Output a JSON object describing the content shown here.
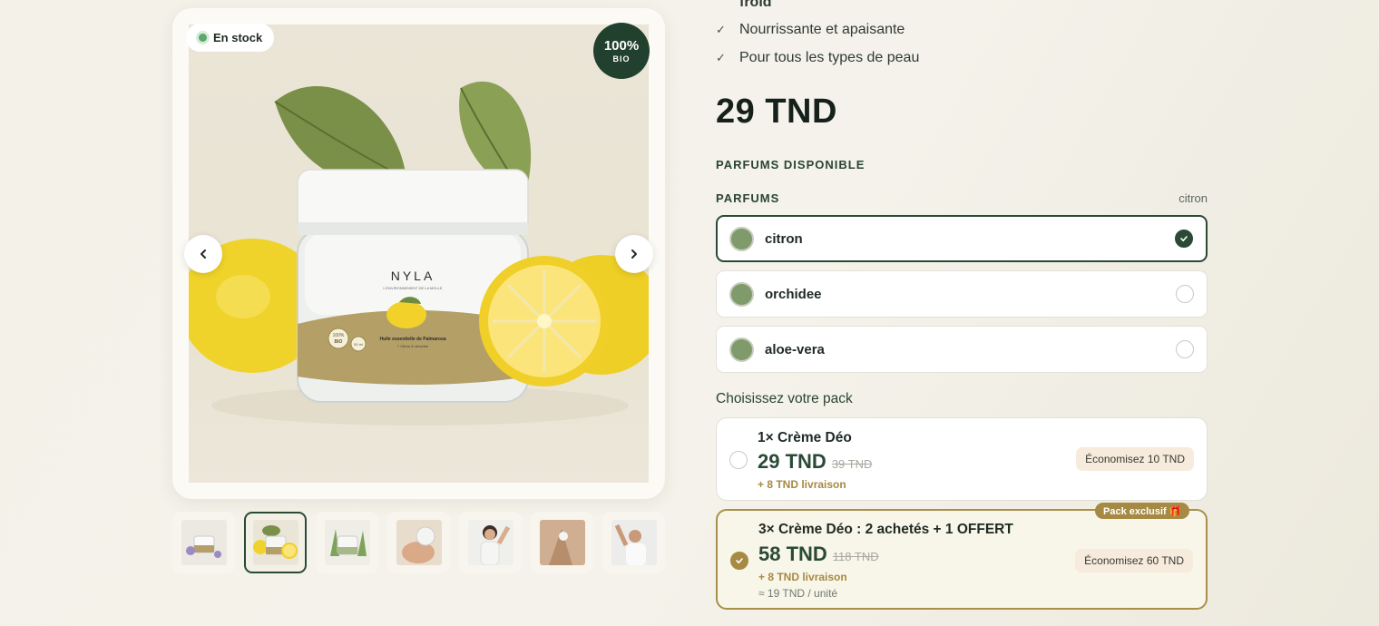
{
  "gallery": {
    "stock_label": "En stock",
    "bio_badge": {
      "percent": "100%",
      "label": "BIO"
    },
    "product_brand": "NYLA",
    "product_tagline": "L'ENVIRONNEMENT DE LA MOLLE",
    "product_line": "Huile essentielle de Palmarosa",
    "product_subline": "+ Citron & verveine",
    "jar_badge": {
      "percent": "100%",
      "label": "BIO"
    },
    "jar_weight": "50 ml",
    "thumbnails": [
      "lavender-jar",
      "lemon-jar",
      "aloe-jar",
      "hand-cream",
      "woman-underarm",
      "hand-applying",
      "man-underarm"
    ],
    "active_thumbnail": 1
  },
  "product": {
    "cut_title": "froid",
    "features": [
      "Nourrissante et apaisante",
      "Pour tous les types de peau"
    ],
    "price": "29 TND"
  },
  "scents": {
    "section_title": "PARFUMS DISPONIBLE",
    "label": "PARFUMS",
    "selected_value": "citron",
    "options": [
      {
        "label": "citron",
        "selected": true,
        "color": "#7f9a6b"
      },
      {
        "label": "orchidee",
        "selected": false,
        "color": "#7f9a6b"
      },
      {
        "label": "aloe-vera",
        "selected": false,
        "color": "#7f9a6b"
      }
    ]
  },
  "packs": {
    "title": "Choisissez votre pack",
    "exclusive_tag": "Pack exclusif 🎁",
    "items": [
      {
        "name": "1× Crème Déo",
        "price": "29 TND",
        "old_price": "39 TND",
        "shipping": "+ 8 TND livraison",
        "unit": "",
        "savings": "Économisez 10 TND",
        "selected": false
      },
      {
        "name": "3× Crème Déo : 2 achetés + 1 OFFERT",
        "price": "58 TND",
        "old_price": "118 TND",
        "shipping": "+ 8 TND livraison",
        "unit": "≈ 19 TND / unité",
        "savings": "Économisez 60 TND",
        "selected": true
      }
    ]
  },
  "colors": {
    "brand_green": "#2a4a36",
    "gold": "#a68a44",
    "in_stock": "#5aa86a"
  }
}
